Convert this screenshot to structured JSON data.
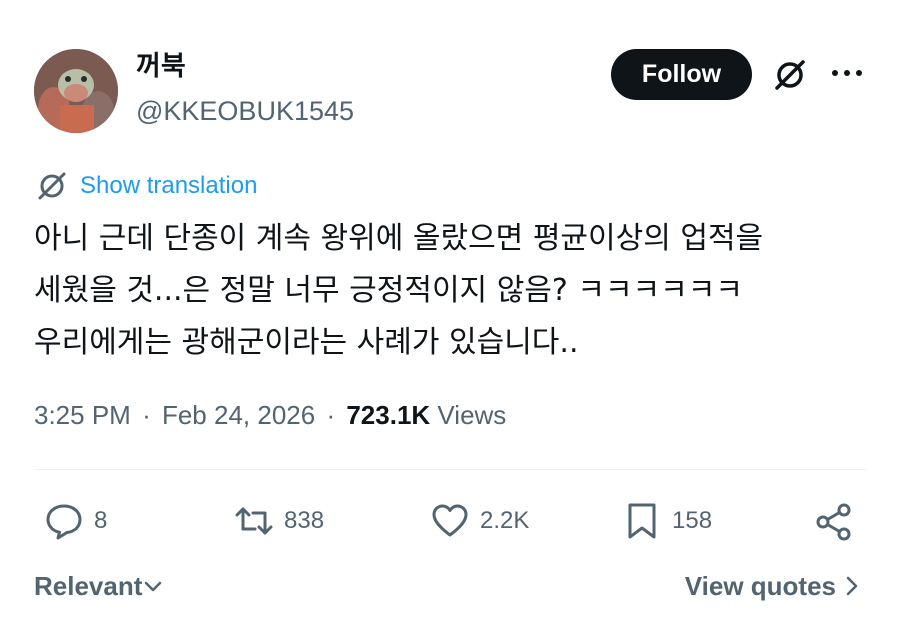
{
  "author": {
    "display_name": "꺼북",
    "handle": "@KKEOBUK1545",
    "avatar_icon": "turtle-avatar"
  },
  "header": {
    "follow_label": "Follow",
    "grok_icon": "grok-icon",
    "more_icon": "more-dots-icon"
  },
  "translation": {
    "label": "Show translation",
    "icon": "globe-translate-icon"
  },
  "tweet": {
    "lines": [
      "아니 근데 단종이 계속 왕위에 올랐으면 평균이상의 업적을",
      "세웠을 것...은 정말 너무 긍정적이지 않음? ㅋㅋㅋㅋㅋㅋ",
      "우리에게는 광해군이라는 사례가 있습니다.."
    ]
  },
  "meta": {
    "time": "3:25 PM",
    "separator": "·",
    "date": "Feb 24, 2026",
    "views_count": "723.1K",
    "views_label": "Views"
  },
  "actions": {
    "replies": "8",
    "reposts": "838",
    "likes": "2.2K",
    "bookmarks": "158"
  },
  "footer": {
    "sort_label": "Relevant",
    "quotes_label": "View quotes"
  },
  "colors": {
    "text": "#0f1419",
    "secondary": "#536471",
    "link": "#1d9bf0",
    "follow_bg": "#0f1419"
  }
}
